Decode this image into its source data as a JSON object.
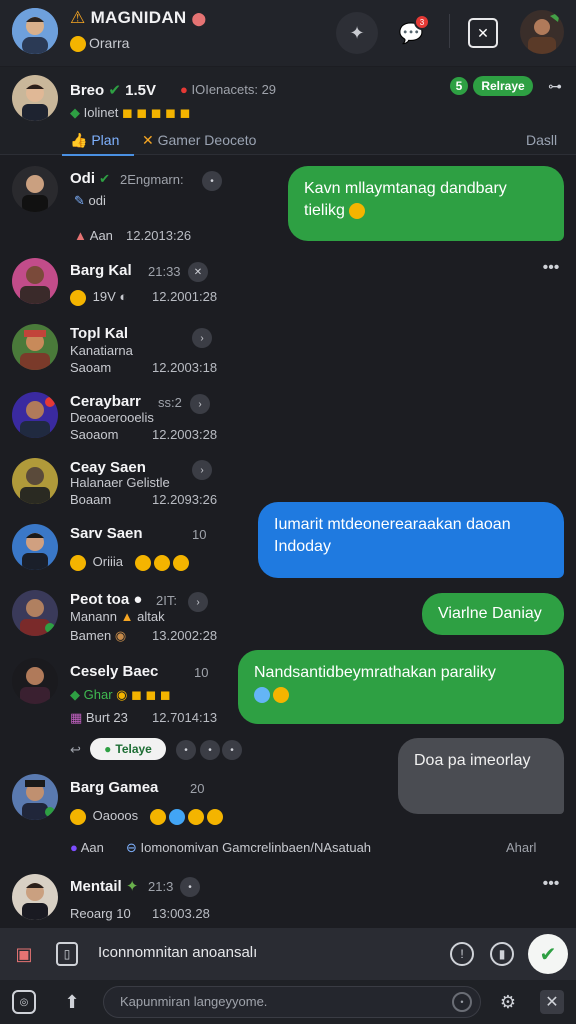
{
  "header": {
    "title": "MAGNIDAN",
    "subtitle": "Orarra",
    "notification_badge": "3"
  },
  "contact": {
    "name": "Breo",
    "version": "1.5V",
    "status_text": "IOIenacets: 29",
    "line2": "Iolinet",
    "badge_left": "5",
    "badge_label": "Relraye"
  },
  "tabs": {
    "items": [
      "Plan",
      "Gamer Deoceto"
    ],
    "right_label": "Dasll"
  },
  "conversations": [
    {
      "name": "Odi",
      "meta": "2Engmarn:",
      "line2": "odi",
      "line3": "Aan",
      "time": "12.2013:26"
    },
    {
      "name": "Barg Kal",
      "meta": "21:33",
      "line2": "19V",
      "time": "12.2001:28"
    },
    {
      "name": "Topl Kal",
      "line2": "Kanatiarna",
      "line3": "Saoam",
      "time": "12.2003:18"
    },
    {
      "name": "Ceraybarr",
      "meta": "ss:2",
      "line2": "Deoaoerooelis",
      "line3": "Saoaom",
      "time": "12.2003:28"
    },
    {
      "name": "Ceay Saen",
      "line2": "Halanaer Gelistle",
      "line3": "Boaam",
      "time": "12.2093:26"
    },
    {
      "name": "Sarv Saen",
      "meta": "10",
      "line2": "Oriiia",
      "time": ""
    },
    {
      "name": "Peot toa",
      "meta": "2IT:",
      "line2": "Manann",
      "line2b": "altak",
      "line3": "Bamen",
      "time": "13.2002:28"
    },
    {
      "name": "Cesely Baec",
      "meta": "10",
      "line2": "Ghar",
      "line3": "Burt 23",
      "time": "12.7014:13"
    },
    {
      "name": "Barg Gamea",
      "meta": "20",
      "line2": "Oaooos",
      "line3": "Aan",
      "line3b": "Iomonomivan Gamcrelinbaen/NAsatuah",
      "time": ""
    },
    {
      "name": "Mentail",
      "meta": "21:3",
      "line3": "Reoarg 10",
      "time": "13:003.28"
    }
  ],
  "bubbles": {
    "b1": "Kavn mllaymtanag dandbary tielikg",
    "b2": "Iumarit mtdeonerearaakan daoan Indoday",
    "b3": "Viarlne Daniay",
    "b4": "Nandsantidbeymrathakan paraliky",
    "b5": "Doa pa imeorlay",
    "b5_time": "Aharl"
  },
  "pill_relaye": "Telaye",
  "compose": {
    "placeholder": "Iconnomnitan anoansalı"
  },
  "bottom": {
    "search_placeholder": "Kapunmiran langeyyome."
  },
  "colors": {
    "green": "#2ea043",
    "blue": "#1f7ae0",
    "gray": "#4a4c52",
    "accent": "#4a90e2"
  }
}
